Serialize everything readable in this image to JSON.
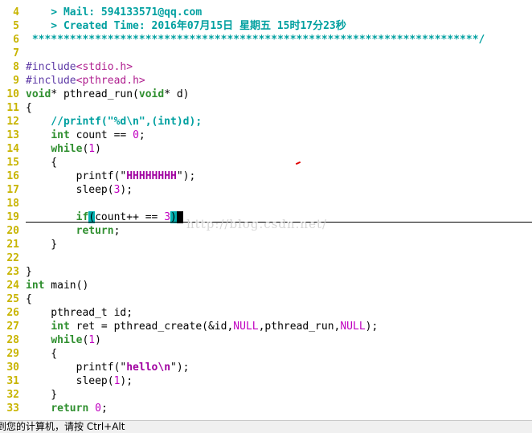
{
  "editor": {
    "lines": [
      {
        "num": "4",
        "tokens": [
          {
            "t": "    > Mail: 594133571@qq.com",
            "c": "cmt-b"
          }
        ]
      },
      {
        "num": "5",
        "tokens": [
          {
            "t": "    > Created Time: 2016年07月15日 星期五 15时17分23秒",
            "c": "cmt-b"
          }
        ]
      },
      {
        "num": "6",
        "tokens": [
          {
            "t": " ***********************************************************************/",
            "c": "cmt-b"
          }
        ]
      },
      {
        "num": "7",
        "tokens": []
      },
      {
        "num": "8",
        "tokens": [
          {
            "t": "#include",
            "c": "pp"
          },
          {
            "t": "<stdio.h>",
            "c": "ppstr"
          }
        ]
      },
      {
        "num": "9",
        "tokens": [
          {
            "t": "#include",
            "c": "pp"
          },
          {
            "t": "<pthread.h>",
            "c": "ppstr"
          }
        ]
      },
      {
        "num": "10",
        "tokens": [
          {
            "t": "void",
            "c": "kw"
          },
          {
            "t": "* pthread_run("
          },
          {
            "t": "void",
            "c": "kw"
          },
          {
            "t": "* d)"
          }
        ]
      },
      {
        "num": "11",
        "tokens": [
          {
            "t": "{"
          }
        ]
      },
      {
        "num": "12",
        "tokens": [
          {
            "t": "    //printf(\"%d\\n\",(int)d);",
            "c": "cmt-b"
          }
        ]
      },
      {
        "num": "13",
        "tokens": [
          {
            "t": "    "
          },
          {
            "t": "int",
            "c": "kw"
          },
          {
            "t": " count == "
          },
          {
            "t": "0",
            "c": "const"
          },
          {
            "t": ";"
          }
        ]
      },
      {
        "num": "14",
        "tokens": [
          {
            "t": "    "
          },
          {
            "t": "while",
            "c": "kw"
          },
          {
            "t": "("
          },
          {
            "t": "1",
            "c": "const"
          },
          {
            "t": ")"
          }
        ]
      },
      {
        "num": "15",
        "tokens": [
          {
            "t": "    {"
          }
        ]
      },
      {
        "num": "16",
        "tokens": [
          {
            "t": "        printf(\""
          },
          {
            "t": "HHHHHHHH",
            "c": "esc"
          },
          {
            "t": "\");"
          }
        ]
      },
      {
        "num": "17",
        "tokens": [
          {
            "t": "        sleep("
          },
          {
            "t": "3",
            "c": "const"
          },
          {
            "t": ");"
          }
        ]
      },
      {
        "num": "18",
        "tokens": []
      },
      {
        "num": "19",
        "tokens": [
          {
            "t": "        "
          },
          {
            "t": "if",
            "c": "kw"
          },
          {
            "t": "(",
            "c": "hl"
          },
          {
            "t": "count++ == "
          },
          {
            "t": "3",
            "c": "const"
          },
          {
            "t": ")",
            "c": "hl"
          },
          {
            "t": " ",
            "c": "cursor"
          }
        ]
      },
      {
        "num": "20",
        "tokens": [
          {
            "t": "        "
          },
          {
            "t": "return",
            "c": "kw"
          },
          {
            "t": ";"
          }
        ]
      },
      {
        "num": "21",
        "tokens": [
          {
            "t": "    }"
          }
        ]
      },
      {
        "num": "22",
        "tokens": []
      },
      {
        "num": "23",
        "tokens": [
          {
            "t": "}"
          }
        ]
      },
      {
        "num": "24",
        "tokens": [
          {
            "t": "int",
            "c": "kw"
          },
          {
            "t": " main()"
          }
        ]
      },
      {
        "num": "25",
        "tokens": [
          {
            "t": "{"
          }
        ]
      },
      {
        "num": "26",
        "tokens": [
          {
            "t": "    pthread_t id;"
          }
        ]
      },
      {
        "num": "27",
        "tokens": [
          {
            "t": "    "
          },
          {
            "t": "int",
            "c": "kw"
          },
          {
            "t": " ret = pthread_create(&id,"
          },
          {
            "t": "NULL",
            "c": "const"
          },
          {
            "t": ",pthread_run,"
          },
          {
            "t": "NULL",
            "c": "const"
          },
          {
            "t": ");"
          }
        ]
      },
      {
        "num": "28",
        "tokens": [
          {
            "t": "    "
          },
          {
            "t": "while",
            "c": "kw"
          },
          {
            "t": "("
          },
          {
            "t": "1",
            "c": "const"
          },
          {
            "t": ")"
          }
        ]
      },
      {
        "num": "29",
        "tokens": [
          {
            "t": "    {"
          }
        ]
      },
      {
        "num": "30",
        "tokens": [
          {
            "t": "        printf(\""
          },
          {
            "t": "hello\\n",
            "c": "esc"
          },
          {
            "t": "\");"
          }
        ]
      },
      {
        "num": "31",
        "tokens": [
          {
            "t": "        sleep("
          },
          {
            "t": "1",
            "c": "const"
          },
          {
            "t": ");"
          }
        ]
      },
      {
        "num": "32",
        "tokens": [
          {
            "t": "    }"
          }
        ]
      },
      {
        "num": "33",
        "tokens": [
          {
            "t": "    "
          },
          {
            "t": "return",
            "c": "kw"
          },
          {
            "t": " "
          },
          {
            "t": "0",
            "c": "const"
          },
          {
            "t": ";"
          }
        ]
      }
    ]
  },
  "watermark": "http://blog.csdn.net/",
  "statusbar": {
    "text": "到您的计算机，请按 Ctrl+Alt"
  }
}
